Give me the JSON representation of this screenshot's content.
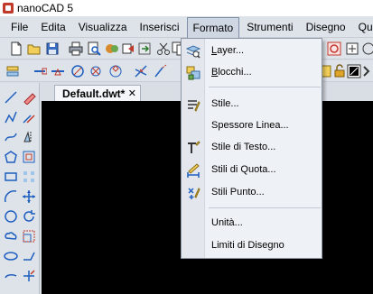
{
  "window": {
    "title": "nanoCAD 5"
  },
  "menubar": {
    "items": [
      {
        "label": "File"
      },
      {
        "label": "Edita"
      },
      {
        "label": "Visualizza"
      },
      {
        "label": "Inserisci"
      },
      {
        "label": "Formato"
      },
      {
        "label": "Strumenti"
      },
      {
        "label": "Disegno"
      },
      {
        "label": "Quot"
      }
    ],
    "active": "Formato"
  },
  "document": {
    "tab_label": "Default.dwt*",
    "close_glyph": "✕"
  },
  "format_menu": {
    "items": [
      {
        "label": "Layer...",
        "icon": "layer-icon"
      },
      {
        "label": "Blocchi...",
        "icon": "blocks-icon"
      },
      {
        "label": "Stile...",
        "icon": "style-icon"
      },
      {
        "label": "Spessore Linea...",
        "icon": ""
      },
      {
        "label": "Stile di Testo...",
        "icon": "text-style-icon"
      },
      {
        "label": "Stili di Quota...",
        "icon": "dimension-style-icon"
      },
      {
        "label": "Stili Punto...",
        "icon": "point-style-icon"
      },
      {
        "label": "Unità...",
        "icon": ""
      },
      {
        "label": "Limiti di Disegno",
        "icon": ""
      }
    ]
  },
  "colors": {
    "menu_background": "#eef1f5",
    "toolbar_background": "#dee3ea",
    "canvas_background": "#000000",
    "active_menu": "#cfd7e2"
  }
}
